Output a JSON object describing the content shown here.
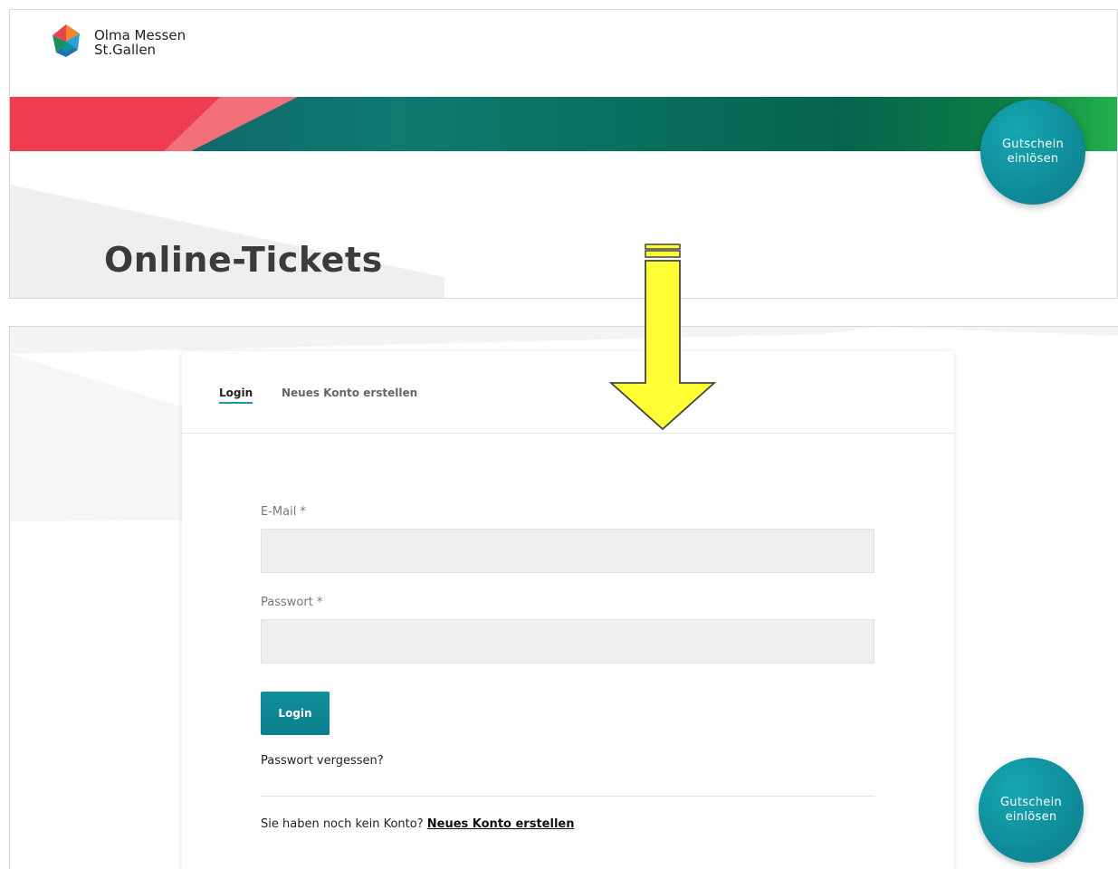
{
  "brand": {
    "name_line1": "Olma Messen",
    "name_line2": "St.Gallen",
    "logo_icon": "olma-logo-icon"
  },
  "header": {
    "page_title": "Online-Tickets"
  },
  "voucher_button": {
    "line1": "Gutschein",
    "line2": "einlösen"
  },
  "tabs": [
    {
      "label": "Login",
      "active": true
    },
    {
      "label": "Neues Konto erstellen",
      "active": false
    }
  ],
  "form": {
    "email_label": "E-Mail *",
    "email_value": "",
    "password_label": "Passwort *",
    "password_value": "",
    "login_button": "Login",
    "forgot_link": "Passwort vergessen?",
    "no_account_text": "Sie haben noch kein Konto?",
    "register_link": "Neues Konto erstellen"
  },
  "colors": {
    "accent_teal": "#0f8c99",
    "banner_red": "#ef3d4f",
    "banner_green": "#1fb14a",
    "arrow_yellow": "#ffff33"
  }
}
